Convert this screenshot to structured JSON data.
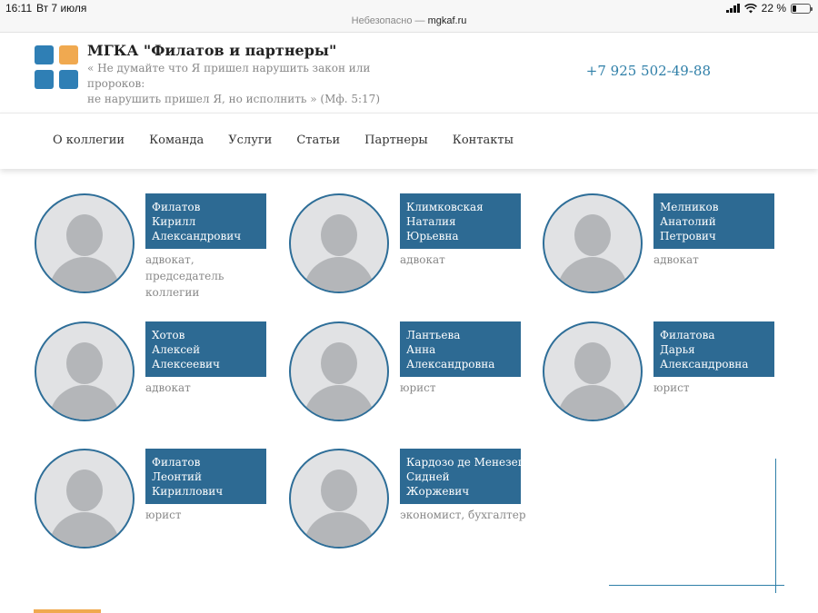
{
  "status_bar": {
    "time": "16:11",
    "date": "Вт 7 июля",
    "battery": "22 %",
    "battery_level": 0.22,
    "url_prefix": "Небезопасно — ",
    "url_host": "mgkaf.ru"
  },
  "header": {
    "title": "МГКА \"Филатов и партнеры\"",
    "quote_line1": "« Не думайте что Я пришел нарушить закон или пророков:",
    "quote_line2": "не нарушить пришел Я, но исполнить » (Мф. 5:17)",
    "phone": "+7 925 502-49-88"
  },
  "logo_colors": [
    "#2f7fb5",
    "#f0a950",
    "#2f7fb5",
    "#2f7fb5"
  ],
  "nav": {
    "items": [
      "О коллегии",
      "Команда",
      "Услуги",
      "Статьи",
      "Партнеры",
      "Контакты"
    ]
  },
  "team": [
    {
      "name": [
        "Филатов",
        "Кирилл",
        "Александрович"
      ],
      "role": "адвокат, председатель коллегии"
    },
    {
      "name": [
        "Климковская",
        "Наталия",
        "Юрьевна"
      ],
      "role": "адвокат"
    },
    {
      "name": [
        "Мелников",
        "Анатолий",
        "Петрович"
      ],
      "role": "адвокат"
    },
    {
      "name": [
        "Хотов",
        "Алексей",
        "Алексеевич"
      ],
      "role": "адвокат"
    },
    {
      "name": [
        "Лантьева",
        "Анна",
        "Александровна"
      ],
      "role": "юрист"
    },
    {
      "name": [
        "Филатова",
        "Дарья",
        "Александровна"
      ],
      "role": "юрист"
    },
    {
      "name": [
        "Филатов",
        "Леонтий",
        "Кириллович"
      ],
      "role": "юрист"
    },
    {
      "name": [
        "Кардозо де Менезеш",
        "Сидней",
        "Жоржевич"
      ],
      "role": "экономист, бухгалтер"
    }
  ],
  "colors": {
    "accent": "#2d6a93",
    "link": "#2f7fa8",
    "highlight": "#f0a950"
  }
}
